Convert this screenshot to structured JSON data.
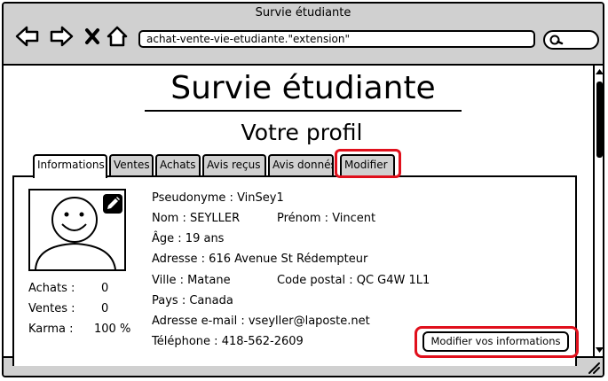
{
  "window": {
    "title": "Survie étudiante"
  },
  "browser": {
    "url": "achat-vente-vie-etudiante.\"extension\"",
    "icons": [
      "back-arrow-icon",
      "forward-arrow-icon",
      "close-icon",
      "home-icon",
      "search-icon"
    ]
  },
  "page": {
    "site_title": "Survie étudiante",
    "heading": "Votre profil"
  },
  "tabs": [
    {
      "label": "Informations",
      "active": true
    },
    {
      "label": "Ventes",
      "active": false
    },
    {
      "label": "Achats",
      "active": false
    },
    {
      "label": "Avis reçus",
      "active": false
    },
    {
      "label": "Avis donnés",
      "active": false
    },
    {
      "label": "Modifier",
      "active": false,
      "highlighted": true
    }
  ],
  "stats": {
    "achats_label": "Achats :",
    "achats_value": "0",
    "ventes_label": "Ventes :",
    "ventes_value": "0",
    "karma_label": "Karma :",
    "karma_value": "100 %"
  },
  "profile": {
    "pseudonyme_label": "Pseudonyme :",
    "pseudonyme": "VinSey1",
    "nom_label": "Nom :",
    "nom": "SEYLLER",
    "prenom_label": "Prénom :",
    "prenom": "Vincent",
    "age_label": "Âge :",
    "age": "19 ans",
    "adresse_label": "Adresse :",
    "adresse": "616 Avenue St Rédempteur",
    "ville_label": "Ville :",
    "ville": "Matane",
    "code_postal_label": "Code postal :",
    "code_postal": "QC G4W 1L1",
    "pays_label": "Pays :",
    "pays": "Canada",
    "email_label": "Adresse e-mail :",
    "email": "vseyller@laposte.net",
    "telephone_label": "Téléphone :",
    "telephone": "418-562-2609"
  },
  "actions": {
    "edit_button": "Modifier vos informations"
  },
  "colors": {
    "chrome": "#d0d0d0",
    "highlight": "#e0101c"
  }
}
